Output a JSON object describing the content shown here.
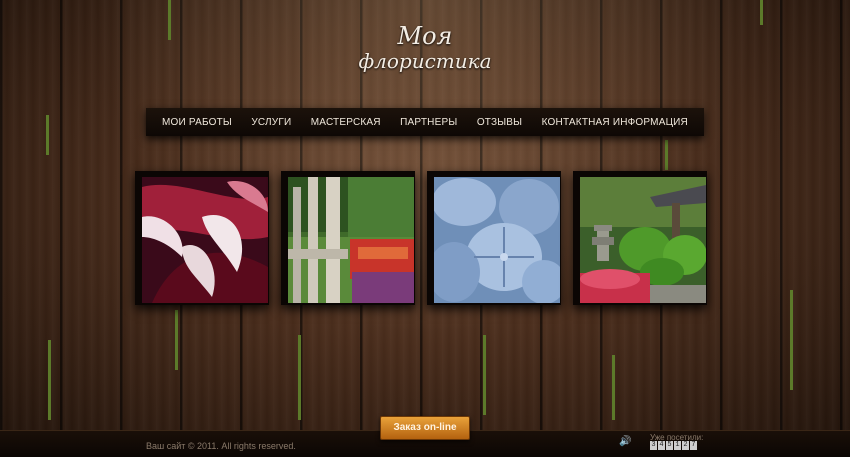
{
  "logo": {
    "line1": "Моя",
    "line2": "флористика"
  },
  "nav": {
    "items": [
      {
        "label": "МОИ РАБОТЫ"
      },
      {
        "label": "УСЛУГИ"
      },
      {
        "label": "МАСТЕРСКАЯ"
      },
      {
        "label": "ПАРТНЕРЫ"
      },
      {
        "label": "ОТЗЫВЫ"
      },
      {
        "label": "КОНТАКТНАЯ ИНФОРМАЦИЯ"
      }
    ]
  },
  "gallery": {
    "photos": [
      {
        "subject": "flower-petals-photo"
      },
      {
        "subject": "garden-fence-photo"
      },
      {
        "subject": "hydrangea-photo"
      },
      {
        "subject": "japanese-garden-photo"
      }
    ]
  },
  "footer": {
    "copyright": "Ваш сайт © 2011. All rights reserved.",
    "order_button": "Заказ on-line",
    "visits_label": "Уже посетили:",
    "visits_digits": [
      "3",
      "4",
      "5",
      "1",
      "2",
      "7"
    ]
  },
  "colors": {
    "accent": "#d98a24",
    "nav_bg": "#140c07",
    "text": "#f0e8dc"
  }
}
